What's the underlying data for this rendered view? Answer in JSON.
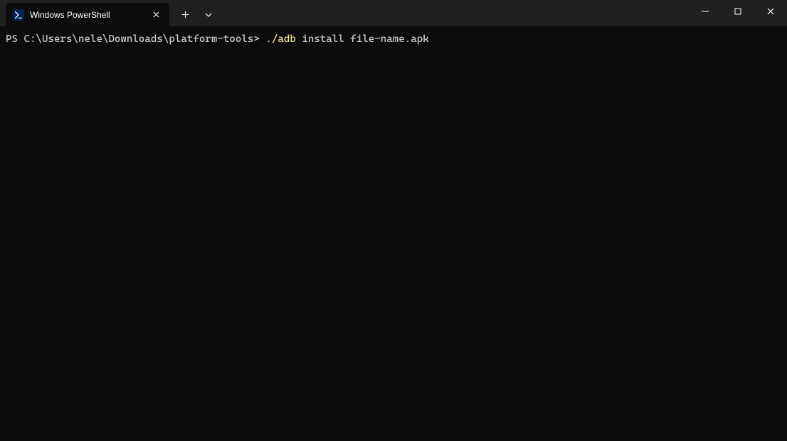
{
  "tab": {
    "title": "Windows PowerShell"
  },
  "terminal": {
    "prompt": "PS C:\\Users\\nele\\Downloads\\platform-tools> ",
    "cmd_prefix": ".",
    "cmd_highlight": "/adb",
    "cmd_args": " install file-name.apk"
  }
}
